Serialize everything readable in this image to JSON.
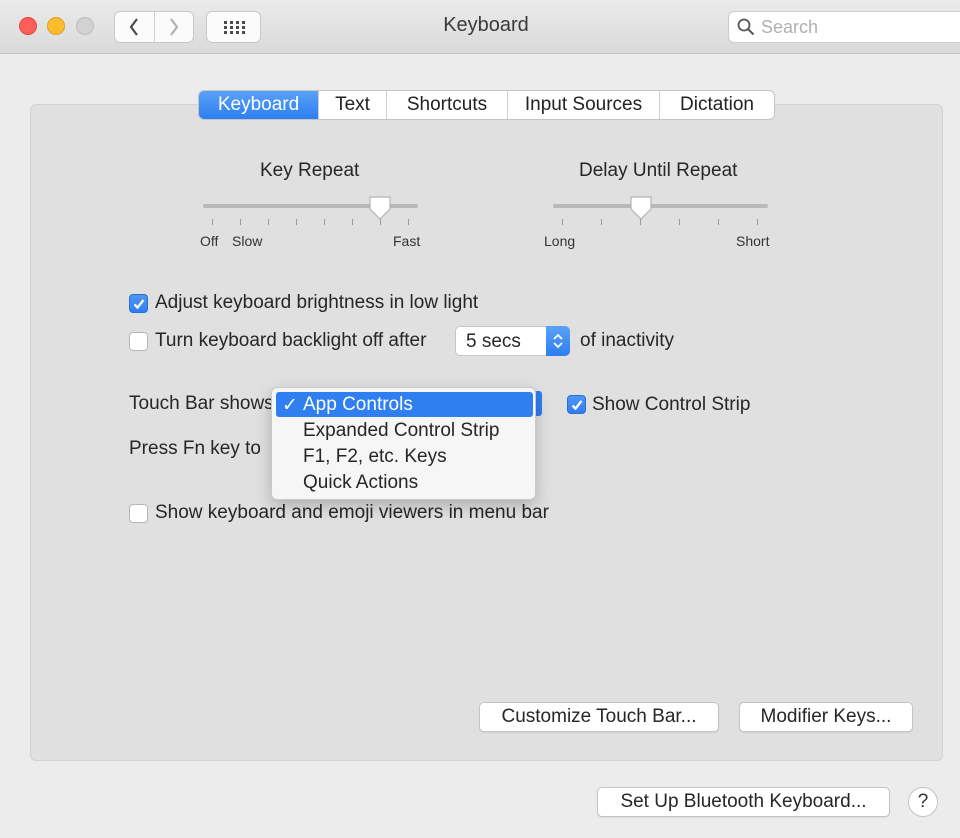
{
  "window": {
    "title": "Keyboard",
    "search_placeholder": "Search"
  },
  "tabs": [
    {
      "label": "Keyboard",
      "active": true
    },
    {
      "label": "Text",
      "active": false
    },
    {
      "label": "Shortcuts",
      "active": false
    },
    {
      "label": "Input Sources",
      "active": false
    },
    {
      "label": "Dictation",
      "active": false
    }
  ],
  "key_repeat": {
    "title": "Key Repeat",
    "labels": {
      "off": "Off",
      "slow": "Slow",
      "fast": "Fast"
    },
    "level": 0.82
  },
  "delay_until_repeat": {
    "title": "Delay Until Repeat",
    "labels": {
      "long": "Long",
      "short": "Short"
    },
    "level": 0.4
  },
  "options": {
    "adjust_brightness": {
      "label": "Adjust keyboard brightness in low light",
      "checked": true
    },
    "backlight_off": {
      "label": "Turn keyboard backlight off after",
      "checked": false,
      "value": "5 secs",
      "suffix": "of inactivity"
    },
    "touch_bar_shows": {
      "label": "Touch Bar shows"
    },
    "show_control_strip": {
      "label": "Show Control Strip",
      "checked": true
    },
    "press_fn": {
      "label": "Press Fn key to"
    },
    "emoji_viewers": {
      "label": "Show keyboard and emoji viewers in menu bar",
      "checked": false
    }
  },
  "touch_bar_menu": {
    "check_mark": "✓",
    "items": [
      "App Controls",
      "Expanded Control Strip",
      "F1, F2, etc. Keys",
      "Quick Actions"
    ],
    "selected": 0
  },
  "buttons": {
    "customize": "Customize Touch Bar...",
    "modifier": "Modifier Keys...",
    "bluetooth": "Set Up Bluetooth Keyboard...",
    "help": "?"
  },
  "colors": {
    "accent": "#2f7ff1",
    "close": "#fc5f57",
    "minimize": "#fdbc2e",
    "zoom_disabled": "#d2d2d2"
  }
}
